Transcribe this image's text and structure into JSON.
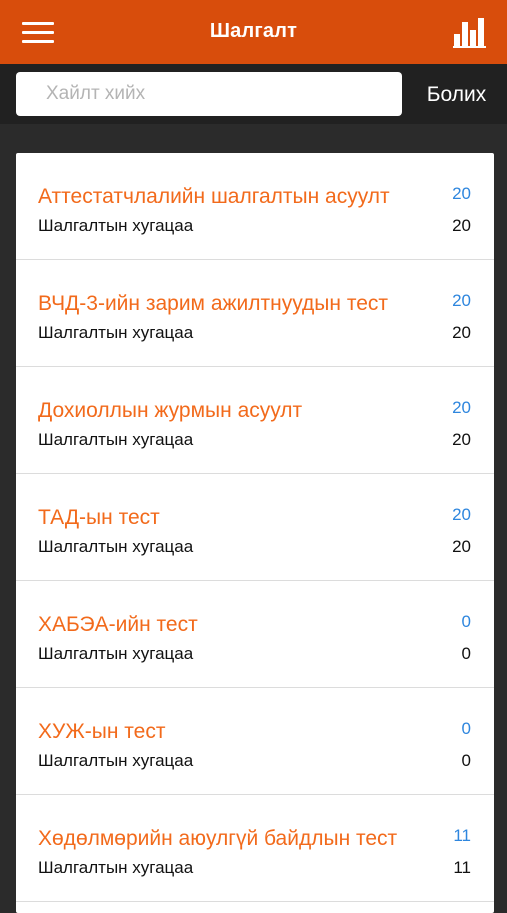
{
  "app_bar": {
    "title": "Шалгалт",
    "menu_icon": "hamburger-menu-icon",
    "chart_icon": "bar-chart-icon",
    "color": "#d84d0c"
  },
  "search": {
    "placeholder": "Хайлт хийх",
    "value": "",
    "cancel_label": "Болих"
  },
  "exams": [
    {
      "title": "Аттестатчлалийн шалгалтын асуулт",
      "count": "20",
      "subtitle": "Шалгалтын хугацаа",
      "duration": "20"
    },
    {
      "title": "ВЧД-3-ийн зарим ажилтнуудын тест",
      "count": "20",
      "subtitle": "Шалгалтын хугацаа",
      "duration": "20"
    },
    {
      "title": "Дохиоллын журмын асуулт",
      "count": "20",
      "subtitle": "Шалгалтын хугацаа",
      "duration": "20"
    },
    {
      "title": "ТАД-ын тест",
      "count": "20",
      "subtitle": "Шалгалтын хугацаа",
      "duration": "20"
    },
    {
      "title": "ХАБЭА-ийн тест",
      "count": "0",
      "subtitle": "Шалгалтын хугацаа",
      "duration": "0"
    },
    {
      "title": "ХУЖ-ын тест",
      "count": "0",
      "subtitle": "Шалгалтын хугацаа",
      "duration": "0"
    },
    {
      "title": "Хөдөлмөрийн аюулгүй байдлын тест",
      "count": "11",
      "subtitle": "Шалгалтын хугацаа",
      "duration": "11"
    }
  ],
  "colors": {
    "title_orange": "#f26a1b",
    "count_blue": "#2e86de",
    "background_dark": "#2b2b2b"
  }
}
